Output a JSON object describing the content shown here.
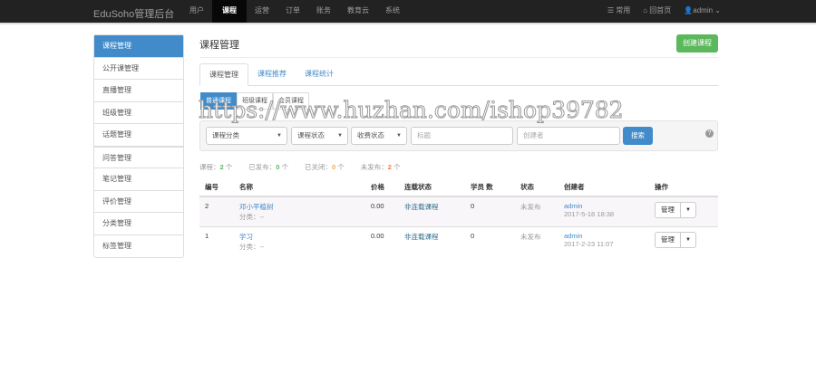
{
  "navbar": {
    "brand": "EduSoho管理后台",
    "items": [
      "用户",
      "课程",
      "运营",
      "订单",
      "账务",
      "教育云",
      "系统"
    ],
    "right": [
      "常用",
      "回首页",
      "admin"
    ]
  },
  "sidebar": [
    "课程管理",
    "公开课管理",
    "直播管理",
    "班级管理",
    "话题管理",
    "问答管理",
    "笔记管理",
    "评价管理",
    "分类管理",
    "标签管理"
  ],
  "page": {
    "title": "课程管理",
    "create": "创建课程"
  },
  "tabs": [
    "课程管理",
    "课程推荐",
    "课程统计"
  ],
  "pills": [
    "普通课程",
    "班级课程",
    "会员课程"
  ],
  "filter": {
    "category": "课程分类",
    "status": "课程状态",
    "charge": "收费状态",
    "title_ph": "标题",
    "creator_ph": "创建者",
    "search": "搜索"
  },
  "stats": {
    "total_label": "课程：",
    "total": "2",
    "published_label": "已发布：",
    "published": "0",
    "closed_label": "已关闭：",
    "closed": "0",
    "unpublished_label": "未发布：",
    "unpublished": "2",
    "unit": "个"
  },
  "table": {
    "headers": [
      "编号",
      "名称",
      "价格",
      "连载状态",
      "学员 数",
      "状态",
      "创建者",
      "操作"
    ],
    "rows": [
      {
        "id": "2",
        "name": "邓小平植树",
        "category": "分类：--",
        "price": "0.00",
        "serial": "非连载课程",
        "students": "0",
        "status": "未发布",
        "creator": "admin",
        "time": "2017-5-18 18:38",
        "action": "管理"
      },
      {
        "id": "1",
        "name": "学习",
        "category": "分类：--",
        "price": "0.00",
        "serial": "非连载课程",
        "students": "0",
        "status": "未发布",
        "creator": "admin",
        "time": "2017-2-23 11:07",
        "action": "管理"
      }
    ]
  },
  "watermark": "https://www.huzhan.com/ishop39782"
}
